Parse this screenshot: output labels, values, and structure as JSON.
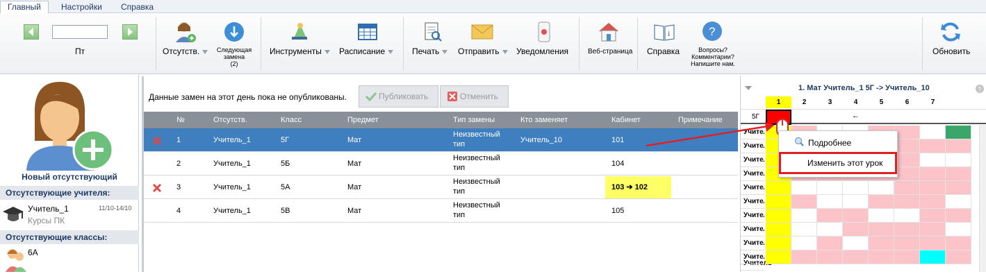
{
  "tabs": [
    "Главный",
    "Настройки",
    "Справка"
  ],
  "ribbon": {
    "day": "Пт",
    "date_value": "",
    "absent": "Отсутств.",
    "next1": "Следующая",
    "next2": "замена",
    "next3": "(2)",
    "tools": "Инструменты",
    "schedule": "Расписание",
    "print": "Печать",
    "send": "Отправить",
    "notify": "Уведомления",
    "web": "Веб-страница",
    "help": "Справка",
    "q1": "Вопросы?",
    "q2": "Комментарии?",
    "q3": "Напишите нам.",
    "refresh": "Обновить"
  },
  "left": {
    "new_absent": "Новый отсутствующий",
    "absent_teachers": "Отсутствующие учителя:",
    "teacher_name": "Учитель_1",
    "teacher_dates": "11/10-14/10",
    "teacher_note": "Курсы ПК",
    "absent_classes": "Отсутствующие классы:",
    "class_name": "6А"
  },
  "mid": {
    "notice": "Данные замен на этот день пока не опубликованы.",
    "publish": "Публиковать",
    "cancel": "Отменить",
    "columns": [
      "№",
      "Отсутств.",
      "Класс",
      "Предмет",
      "Тип замены",
      "Кто заменяет",
      "Кабинет",
      "Примечание"
    ],
    "rows": [
      {
        "n": "1",
        "absent": "Учитель_1",
        "cls": "5Г",
        "subj": "Мат",
        "type1": "Неизвестный",
        "type2": "тип",
        "who": "Учитель_10",
        "room": "101",
        "note": ""
      },
      {
        "n": "2",
        "absent": "Учитель_1",
        "cls": "5Б",
        "subj": "Мат",
        "type1": "Неизвестный",
        "type2": "тип",
        "who": "",
        "room": "104",
        "note": ""
      },
      {
        "n": "3",
        "absent": "Учитель_1",
        "cls": "5А",
        "subj": "Мат",
        "type1": "Неизвестный",
        "type2": "тип",
        "who": "",
        "room": "103 ➔ 102",
        "note": ""
      },
      {
        "n": "4",
        "absent": "Учитель_1",
        "cls": "5В",
        "subj": "Мат",
        "type1": "Неизвестный",
        "type2": "тип",
        "who": "",
        "room": "105",
        "note": ""
      }
    ]
  },
  "right": {
    "title": "1. Мат Учитель_1 5Г -> Учитель_10",
    "periods": [
      "1",
      "2",
      "3",
      "4",
      "5",
      "6",
      "7"
    ],
    "row_class": "5Г",
    "arrow": "←",
    "teacher_label": "Учит",
    "teacher_label_short": "Учитель"
  },
  "context_menu": {
    "details": "Подробнее",
    "change": "Изменить этот урок"
  },
  "colors": {
    "selected_row": "#3f7fbf",
    "highlight": "#ffff00",
    "pink": "#fcc3c8",
    "red": "#ff0000",
    "green": "#3aa66a",
    "cyan": "#00ffff"
  }
}
